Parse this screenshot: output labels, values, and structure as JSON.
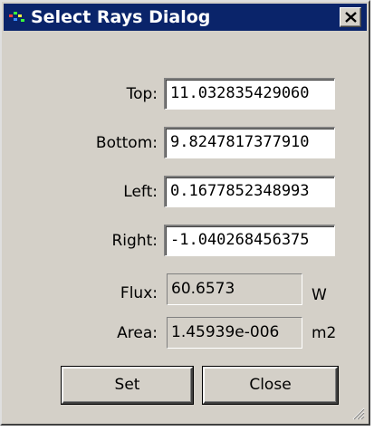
{
  "window": {
    "title": "Select Rays Dialog"
  },
  "fields": [
    {
      "label": "Top:",
      "value": "11.032835429060"
    },
    {
      "label": "Bottom:",
      "value": "9.8247817377910"
    },
    {
      "label": "Left:",
      "value": "0.1677852348993"
    },
    {
      "label": "Right:",
      "value": "-1.040268456375"
    }
  ],
  "readouts": [
    {
      "label": "Flux:",
      "value": "60.6573",
      "unit": "W"
    },
    {
      "label": "Area:",
      "value": "1.45939e-006",
      "unit": "m2"
    }
  ],
  "buttons": {
    "set_label": "Set",
    "close_label": "Close"
  },
  "icons": {
    "app": "app-logo-icon",
    "close": "close-x-icon",
    "grip": "resize-grip-icon"
  },
  "colors": {
    "titlebar": "#0a246a",
    "face": "#d4d0c8"
  }
}
